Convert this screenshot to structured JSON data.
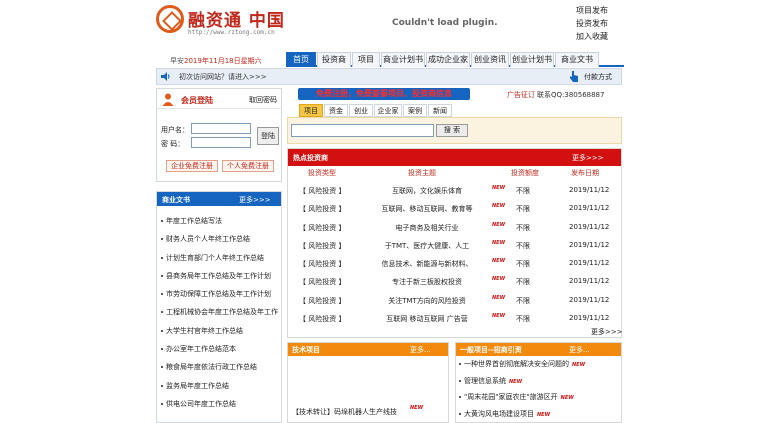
{
  "header": {
    "logo_text": "融资通  中国",
    "logo_url": "http://www.rztong.com.cn",
    "plugin_message": "Couldn't load plugin.",
    "top_links": [
      "项目发布",
      "投资发布",
      "加入收藏"
    ]
  },
  "greeting": {
    "prefix": "早安",
    "date": "2019年11月18日星期六"
  },
  "nav": [
    "首页",
    "投资商",
    "项目",
    "商业计划书",
    "成功企业家",
    "创业资讯",
    "创业计划书",
    "商业文书"
  ],
  "notice": {
    "text": "初次访问网站？请进入>>>",
    "pay_link": "付款方式"
  },
  "login": {
    "title": "会员登陆",
    "forgot": "取回密码",
    "user_label": "用户名：",
    "password_label": "密  码：",
    "user_value": "",
    "password_value": "",
    "submit": "登陆",
    "reg_company": "企业免费注册",
    "reg_person": "个人免费注册"
  },
  "docs": {
    "title": "商业文书",
    "more": "更多>>>",
    "items": [
      "年度工作总结写法",
      "财务人员个人年终工作总结",
      "计划生育部门个人年终工作总结",
      "县商务局年工作总结及年工作计划",
      "市劳动保障工作总结及年工作计划",
      "工程机械协会年度工作总结及年工作",
      "大学生村官年终工作总结",
      "办公室年工作总结范本",
      "粮食局年度依法行政工作总结",
      "监务局年度工作总结",
      "供电公司年度工作总结"
    ]
  },
  "promo": "免费注册，免费查看项目、投资商信息",
  "ad": {
    "label": "广告征订",
    "contact": "联系QQ:380568887"
  },
  "search": {
    "tabs": [
      "项目",
      "资金",
      "创业",
      "企业家",
      "案例",
      "新闻"
    ],
    "placeholder": "",
    "button": "搜 索"
  },
  "hot": {
    "title": "热点投资商",
    "more": "更多>>>",
    "columns": [
      "投资类型",
      "投资主题",
      "投资额度",
      "发布日期"
    ],
    "rows": [
      [
        "【 风险投资 】",
        "互联网，文化娱乐体育",
        "不限",
        "2019/11/12"
      ],
      [
        "【 风险投资 】",
        "互联网、移动互联网、教育等",
        "不限",
        "2019/11/12"
      ],
      [
        "【 风险投资 】",
        "电子商务及相关行业",
        "不限",
        "2019/11/12"
      ],
      [
        "【 风险投资 】",
        "于TMT、医疗大健康、人工",
        "不限",
        "2019/11/12"
      ],
      [
        "【 风险投资 】",
        "信息技术、新能源与新材料、",
        "不限",
        "2019/11/12"
      ],
      [
        "【 风险投资 】",
        "专注于新三板股权投资",
        "不限",
        "2019/11/12"
      ],
      [
        "【 风险投资 】",
        "关注TMT方向的风险投资",
        "不限",
        "2019/11/12"
      ],
      [
        "【 风险投资 】",
        "互联网 移动互联网 广告营",
        "不限",
        "2019/11/12"
      ]
    ],
    "new_badge": "NEW",
    "more_bottom": "更多>>>"
  },
  "tech": {
    "title": "技术项目",
    "more": "更多...",
    "item": "【技术转让】码垛机器人生产线技",
    "new_badge": "NEW"
  },
  "general": {
    "title": "一般项目--招商引资",
    "more": "更多...",
    "items": [
      "一种世界首创彻底解决安全问题的",
      "管理信息系统",
      "\"周末花园\"家庭农庄\"旅游区开",
      "大黄沟风电场建设项目"
    ],
    "new_badge": "NEW"
  },
  "colors": {
    "nav_blue": "#1565c0",
    "hot_red": "#d31010",
    "section_orange": "#f28a0d",
    "brand_red": "#c0281c"
  }
}
